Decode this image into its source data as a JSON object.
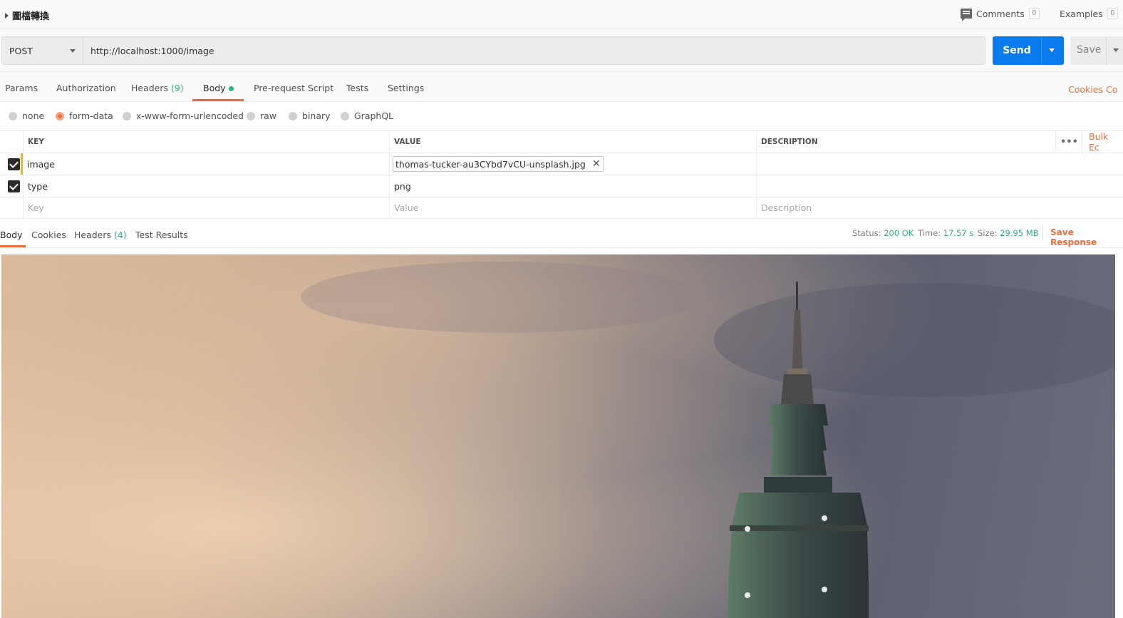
{
  "header": {
    "request_name": "圖檔轉換",
    "comments_label": "Comments",
    "comments_count": "0",
    "examples_label": "Examples",
    "examples_count": "0"
  },
  "request": {
    "method": "POST",
    "url": "http://localhost:1000/image",
    "send_label": "Send",
    "save_label": "Save"
  },
  "request_tabs": {
    "params": "Params",
    "authorization": "Authorization",
    "headers": "Headers",
    "headers_count": "(9)",
    "body": "Body",
    "prerequest": "Pre-request Script",
    "tests": "Tests",
    "settings": "Settings",
    "cookies": "Cookies",
    "code": "Co"
  },
  "body_modes": {
    "none": "none",
    "form_data": "form-data",
    "urlencoded": "x-www-form-urlencoded",
    "raw": "raw",
    "binary": "binary",
    "graphql": "GraphQL",
    "selected": "form-data"
  },
  "form_table": {
    "headers": {
      "key": "KEY",
      "value": "VALUE",
      "description": "DESCRIPTION"
    },
    "bulk_edit": "Bulk Ec",
    "more": "•••",
    "rows": [
      {
        "key": "image",
        "value": "thomas-tucker-au3CYbd7vCU-unsplash.jpg",
        "checked": true
      },
      {
        "key": "type",
        "value": "png",
        "checked": true
      }
    ],
    "placeholders": {
      "key": "Key",
      "value": "Value",
      "description": "Description"
    }
  },
  "response": {
    "tabs": {
      "body": "Body",
      "cookies": "Cookies",
      "headers": "Headers",
      "headers_count": "(4)",
      "tests": "Test Results"
    },
    "status_label": "Status:",
    "status": "200 OK",
    "time_label": "Time:",
    "time": "17.57 s",
    "size_label": "Size:",
    "size": "29.95 MB",
    "save_response": "Save Response"
  }
}
